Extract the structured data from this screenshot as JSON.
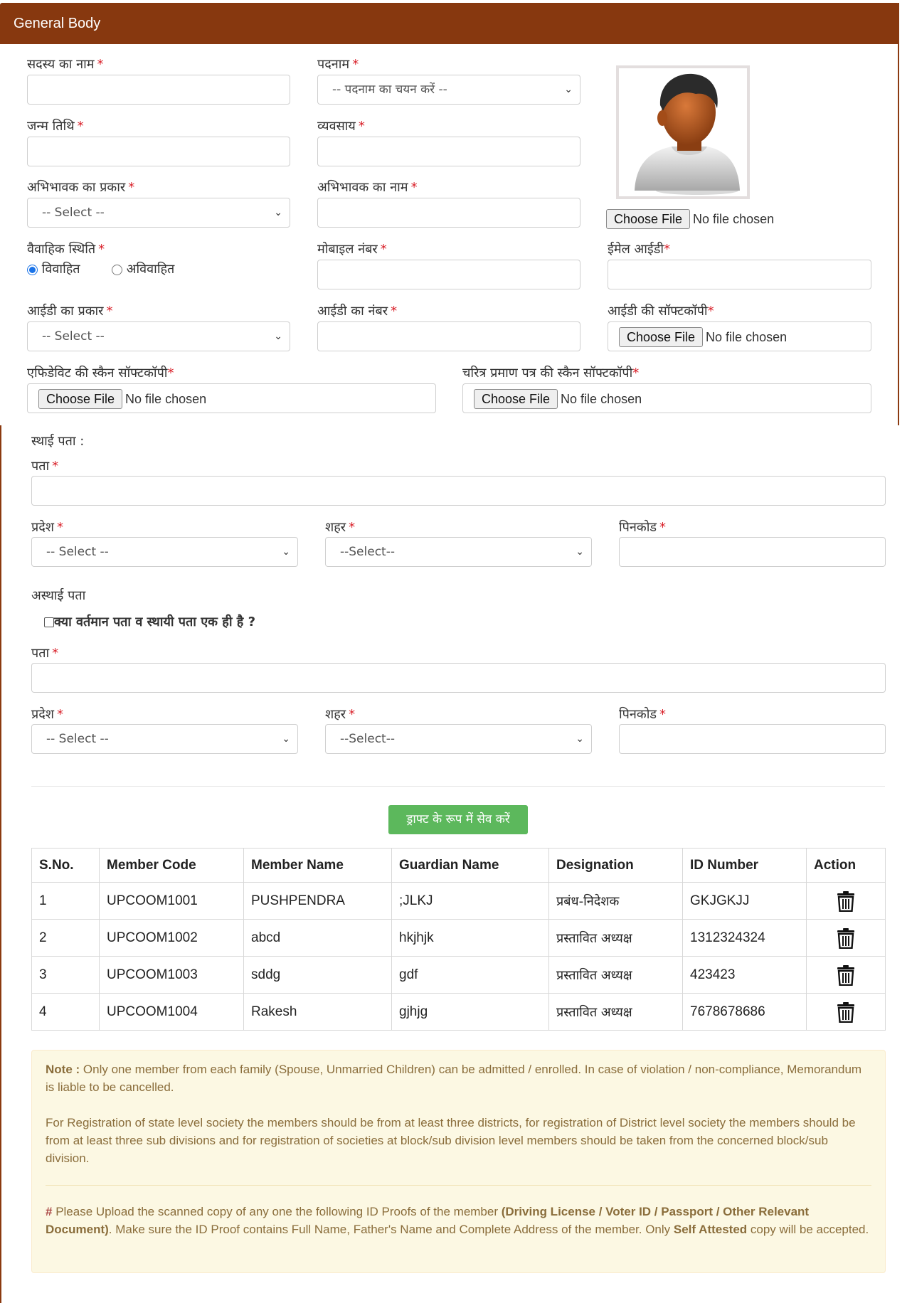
{
  "panel": {
    "title": "General Body"
  },
  "form": {
    "member_name_label": "सदस्य का नाम",
    "designation_label": "पदनाम",
    "designation_value": "-- पदनाम का चयन करें --",
    "dob_label": "जन्म तिथि",
    "occupation_label": "व्यवसाय",
    "guardian_type_label": "अभिभावक का प्रकार",
    "guardian_type_value": "-- Select --",
    "guardian_name_label": "अभिभावक का नाम",
    "marital_label": "वैवाहिक स्थिति",
    "married_label": "विवाहित",
    "unmarried_label": "अविवाहित",
    "mobile_label": "मोबाइल नंबर",
    "email_label": "ईमेल आईडी",
    "id_type_label": "आईडी का प्रकार",
    "id_type_value": "-- Select --",
    "id_number_label": "आईडी का नंबर",
    "id_softcopy_label": "आईडी की सॉफ्टकॉपी",
    "affidavit_label": "एफिडेविट की स्कैन सॉफ्टकॉपी",
    "character_cert_label": "चरित्र प्रमाण पत्र की स्कैन सॉफ्टकॉपी",
    "required_mark": "*",
    "choose_file": "Choose File",
    "no_file": "No file chosen"
  },
  "permanent": {
    "heading": "स्थाई पता :",
    "address_label": "पता",
    "state_label": "प्रदेश",
    "state_value": "-- Select --",
    "city_label": "शहर",
    "city_value": "--Select--",
    "pincode_label": "पिनकोड"
  },
  "temporary": {
    "heading": "अस्थाई पता",
    "same_address_label": "क्या वर्तमान पता व स्थायी पता एक ही है ?",
    "address_label": "पता",
    "state_label": "प्रदेश",
    "state_value": "-- Select --",
    "city_label": "शहर",
    "city_value": "--Select--",
    "pincode_label": "पिनकोड"
  },
  "save_draft_label": "ड्राफ्ट के रूप में सेव करें",
  "table": {
    "headers": [
      "S.No.",
      "Member Code",
      "Member Name",
      "Guardian Name",
      "Designation",
      "ID Number",
      "Action"
    ],
    "rows": [
      [
        "1",
        "UPCOOM1001",
        "PUSHPENDRA",
        ";JLKJ",
        "प्रबंध-निदेशक",
        "GKJGKJJ"
      ],
      [
        "2",
        "UPCOOM1002",
        "abcd",
        "hkjhjk",
        "प्रस्तावित अध्यक्ष",
        "1312324324"
      ],
      [
        "3",
        "UPCOOM1003",
        "sddg",
        "gdf",
        "प्रस्तावित अध्यक्ष",
        "423423"
      ],
      [
        "4",
        "UPCOOM1004",
        "Rakesh",
        "gjhjg",
        "प्रस्तावित अध्यक्ष",
        "7678678686"
      ]
    ]
  },
  "note": {
    "note_label": "Note :",
    "note_text": " Only one member from each family (Spouse, Unmarried Children) can be admitted / enrolled. In case of violation / non-compliance, Memorandum is liable to be cancelled.",
    "registration_text": "For Registration of state level society the members should be from at least three districts, for registration of District level society the members should be from at least three sub divisions and for registration of societies at block/sub division level members should be taken from the concerned block/sub division.",
    "hash": "#",
    "upload_text_1": " Please Upload the scanned copy of any one the following ID Proofs of the member ",
    "upload_bold": "(Driving License / Voter ID / Passport / Other Relevant Document)",
    "upload_text_2": ". Make sure the ID Proof contains Full Name, Father's Name and Complete Address of the member. Only ",
    "self_attested": "Self Attested",
    "upload_text_3": " copy will be accepted."
  },
  "colors": {
    "header_bg": "#87380f",
    "required": "#d9212a",
    "save_button": "#5cb85c",
    "note_bg": "#fcf8e3",
    "note_text": "#8a6d3b"
  },
  "icons": {
    "avatar": "user-avatar-placeholder",
    "delete": "trash-icon",
    "dropdown": "chevron-down-icon"
  }
}
